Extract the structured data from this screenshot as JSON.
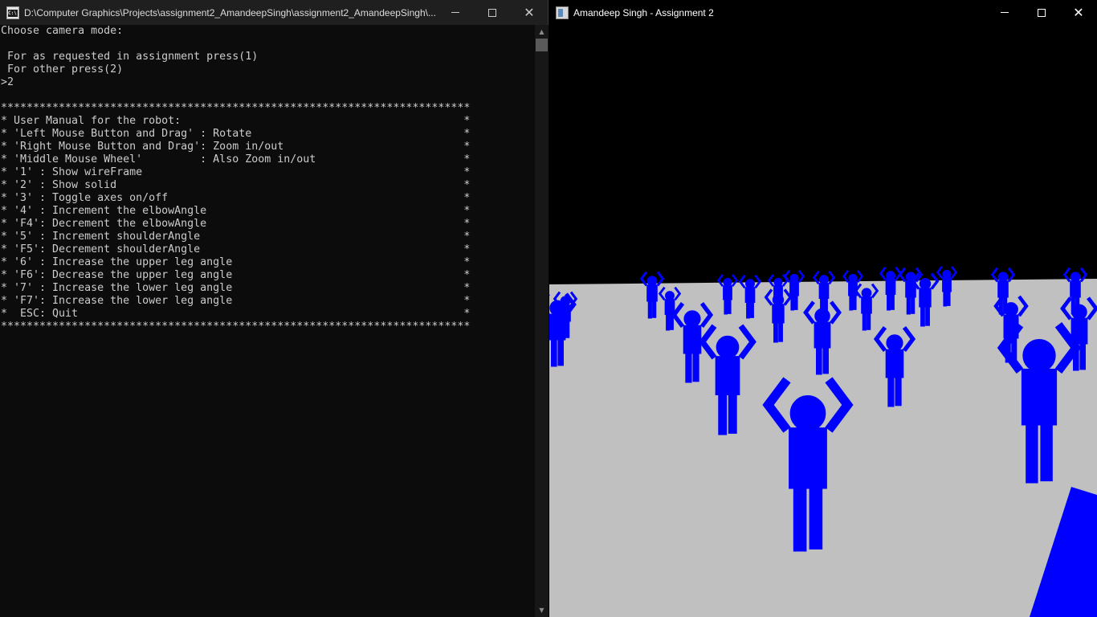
{
  "console_window": {
    "title": "D:\\Computer Graphics\\Projects\\assignment2_AmandeepSingh\\assignment2_AmandeepSingh\\...",
    "controls": {
      "minimize": "minimize-icon",
      "maximize": "maximize-icon",
      "close": "close-icon"
    },
    "lines": [
      "Choose camera mode:",
      "",
      " For as requested in assignment press(1)",
      " For other press(2)",
      ">2",
      "",
      "*************************************************************************",
      "* User Manual for the robot:                                            *",
      "* 'Left Mouse Button and Drag' : Rotate                                 *",
      "* 'Right Mouse Button and Drag': Zoom in/out                            *",
      "* 'Middle Mouse Wheel'         : Also Zoom in/out                       *",
      "* '1' : Show wireFrame                                                  *",
      "* '2' : Show solid                                                      *",
      "* '3' : Toggle axes on/off                                              *",
      "* '4' : Increment the elbowAngle                                        *",
      "* 'F4': Decrement the elbowAngle                                        *",
      "* '5' : Increment shoulderAngle                                         *",
      "* 'F5': Decrement shoulderAngle                                         *",
      "* '6' : Increase the upper leg angle                                    *",
      "* 'F6': Decrease the upper leg angle                                    *",
      "* '7' : Increase the lower leg angle                                    *",
      "* 'F7': Increase the lower leg angle                                    *",
      "*  ESC: Quit                                                            *",
      "*************************************************************************"
    ]
  },
  "gl_window": {
    "title": "Amandeep Singh - Assignment 2",
    "controls": {
      "minimize": "minimize-icon",
      "maximize": "maximize-icon",
      "close": "close-icon"
    },
    "colors": {
      "sky": "#000000",
      "floor": "#c0c0c0",
      "robot": "#0000ff"
    }
  }
}
